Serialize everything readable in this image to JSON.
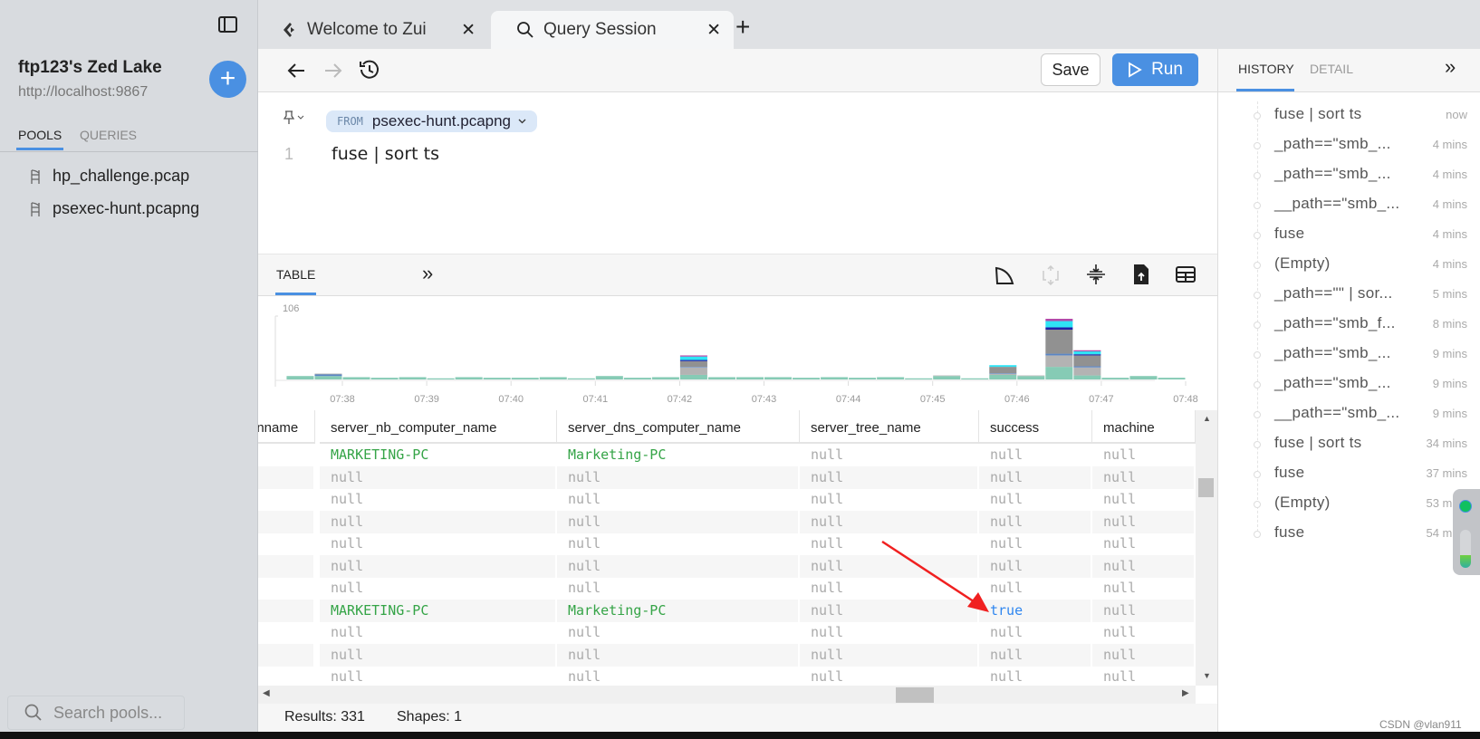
{
  "sidebar": {
    "lake_title": "ftp123's Zed Lake",
    "lake_url": "http://localhost:9867",
    "tabs": [
      "POOLS",
      "QUERIES"
    ],
    "active_tab": "POOLS",
    "pools": [
      "hp_challenge.pcap",
      "psexec-hunt.pcapng"
    ],
    "search_placeholder": "Search pools..."
  },
  "tabs": [
    {
      "label": "Welcome to Zui",
      "icon": "zui-logo-icon"
    },
    {
      "label": "Query Session",
      "icon": "search-icon",
      "active": true
    }
  ],
  "toolbar": {
    "save_label": "Save",
    "run_label": "Run"
  },
  "editor": {
    "from_keyword": "FROM",
    "pool": "psexec-hunt.pcapng",
    "line_number": "1",
    "query": "fuse | sort ts"
  },
  "results": {
    "tab_label": "TABLE",
    "expand": "»",
    "status_results": "Results: 331",
    "status_shapes": "Shapes: 1"
  },
  "chart_data": {
    "type": "bar",
    "stacked": true,
    "ylim": [
      0,
      106
    ],
    "y_max_label": "106",
    "x_ticks": [
      "07:38",
      "07:39",
      "07:40",
      "07:41",
      "07:42",
      "07:43",
      "07:44",
      "07:45",
      "07:46",
      "07:47",
      "07:48"
    ],
    "bin_start": "07:37:20",
    "bin_seconds": 20,
    "series_colors": [
      "#86cbb5",
      "#b3b3b3",
      "#5b86c5",
      "#919191",
      "#2020a8",
      "#2fe4f5",
      "#b24aa9"
    ],
    "bins": [
      [
        6,
        0,
        0,
        0,
        0,
        0,
        0
      ],
      [
        6,
        0,
        3,
        1,
        0,
        0,
        0
      ],
      [
        4,
        0,
        0,
        0,
        0,
        0,
        0
      ],
      [
        3,
        0,
        0,
        0,
        0,
        0,
        0
      ],
      [
        4,
        0,
        0,
        0,
        0,
        0,
        0
      ],
      [
        2,
        0,
        0,
        0,
        0,
        0,
        0
      ],
      [
        4,
        0,
        0,
        0,
        0,
        0,
        0
      ],
      [
        3,
        0,
        0,
        0,
        0,
        0,
        0
      ],
      [
        3,
        0,
        0,
        0,
        0,
        0,
        0
      ],
      [
        4,
        0,
        0,
        0,
        0,
        0,
        0
      ],
      [
        2,
        0,
        0,
        0,
        0,
        0,
        0
      ],
      [
        6,
        0,
        0,
        0,
        0,
        0,
        0
      ],
      [
        3,
        0,
        0,
        0,
        0,
        0,
        0
      ],
      [
        4,
        0,
        0,
        0,
        0,
        0,
        0
      ],
      [
        8,
        13,
        1,
        10,
        2,
        6,
        2
      ],
      [
        4,
        0,
        0,
        0,
        0,
        0,
        0
      ],
      [
        4,
        0,
        0,
        0,
        0,
        0,
        0
      ],
      [
        4,
        0,
        0,
        0,
        0,
        0,
        0
      ],
      [
        3,
        0,
        0,
        0,
        0,
        0,
        0
      ],
      [
        4,
        0,
        0,
        0,
        0,
        0,
        0
      ],
      [
        3,
        0,
        0,
        0,
        0,
        0,
        0
      ],
      [
        4,
        0,
        0,
        0,
        0,
        0,
        0
      ],
      [
        2,
        0,
        0,
        0,
        0,
        0,
        0
      ],
      [
        6,
        1,
        0,
        0,
        0,
        0,
        0
      ],
      [
        2,
        0,
        0,
        0,
        0,
        0,
        0
      ],
      [
        8,
        2,
        1,
        11,
        0,
        3,
        0
      ],
      [
        6,
        1,
        0,
        0,
        0,
        0,
        0
      ],
      [
        22,
        20,
        3,
        42,
        4,
        11,
        4
      ],
      [
        7,
        14,
        2,
        19,
        2,
        5,
        2
      ],
      [
        3,
        0,
        0,
        0,
        0,
        0,
        0
      ],
      [
        6,
        0,
        0,
        0,
        0,
        0,
        0
      ],
      [
        3,
        0,
        0,
        0,
        0,
        0,
        0
      ]
    ]
  },
  "table": {
    "columns": [
      "inname",
      "server_nb_computer_name",
      "server_dns_computer_name",
      "server_tree_name",
      "success",
      "machine"
    ],
    "rows": [
      [
        "",
        "MARKETING-PC",
        "Marketing-PC",
        "null",
        "null",
        "null"
      ],
      [
        "",
        "null",
        "null",
        "null",
        "null",
        "null"
      ],
      [
        "",
        "null",
        "null",
        "null",
        "null",
        "null"
      ],
      [
        "",
        "null",
        "null",
        "null",
        "null",
        "null"
      ],
      [
        "",
        "null",
        "null",
        "null",
        "null",
        "null"
      ],
      [
        "",
        "null",
        "null",
        "null",
        "null",
        "null"
      ],
      [
        "",
        "null",
        "null",
        "null",
        "null",
        "null"
      ],
      [
        "",
        "MARKETING-PC",
        "Marketing-PC",
        "null",
        "true",
        "null"
      ],
      [
        "",
        "null",
        "null",
        "null",
        "null",
        "null"
      ],
      [
        "",
        "null",
        "null",
        "null",
        "null",
        "null"
      ],
      [
        "",
        "null",
        "null",
        "null",
        "null",
        "null"
      ]
    ]
  },
  "right_panel": {
    "tabs": [
      "HISTORY",
      "DETAIL"
    ],
    "active_tab": "HISTORY",
    "collapse": "»",
    "history": [
      {
        "query": "fuse | sort ts",
        "time": "now"
      },
      {
        "query": "_path==\"smb_...",
        "time": "4 mins"
      },
      {
        "query": "_path==\"smb_...",
        "time": "4 mins"
      },
      {
        "query": "__path==\"smb_...",
        "time": "4 mins"
      },
      {
        "query": "fuse",
        "time": "4 mins"
      },
      {
        "query": "(Empty)",
        "time": "4 mins"
      },
      {
        "query": "_path==\"\" | sor...",
        "time": "5 mins"
      },
      {
        "query": "_path==\"smb_f...",
        "time": "8 mins"
      },
      {
        "query": "_path==\"smb_...",
        "time": "9 mins"
      },
      {
        "query": "_path==\"smb_...",
        "time": "9 mins"
      },
      {
        "query": "__path==\"smb_...",
        "time": "9 mins"
      },
      {
        "query": "fuse | sort ts",
        "time": "34 mins"
      },
      {
        "query": "fuse",
        "time": "37 mins"
      },
      {
        "query": "(Empty)",
        "time": "53 mins"
      },
      {
        "query": "fuse",
        "time": "54 mins"
      }
    ]
  },
  "watermark": "CSDN @vlan911",
  "colors": {
    "accent": "#4a90e2",
    "green_value": "#35a447",
    "blue_value": "#2f86f0",
    "annotation_arrow": "#f02020"
  }
}
